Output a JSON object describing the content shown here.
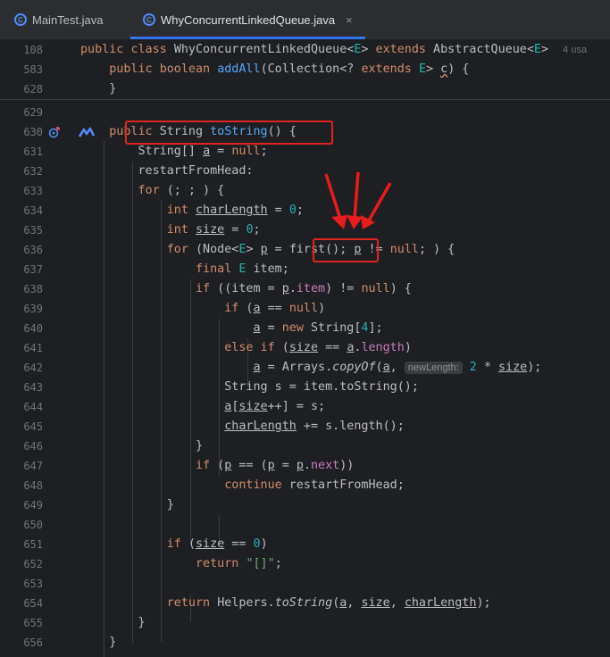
{
  "tabs": [
    {
      "label": "MainTest.java",
      "active": false
    },
    {
      "label": "WhyConcurrentLinkedQueue.java",
      "active": true
    }
  ],
  "tab_close": "×",
  "sticky": [
    {
      "num": "108",
      "tokens": [
        {
          "t": "public ",
          "c": "kw"
        },
        {
          "t": "class ",
          "c": "kw"
        },
        {
          "t": "WhyConcurrentLinkedQueue<",
          "c": ""
        },
        {
          "t": "E",
          "c": "tp"
        },
        {
          "t": "> ",
          "c": ""
        },
        {
          "t": "extends ",
          "c": "kw"
        },
        {
          "t": "AbstractQueue<",
          "c": ""
        },
        {
          "t": "E",
          "c": "tp"
        },
        {
          "t": ">  ",
          "c": ""
        },
        {
          "t": "4 usa",
          "c": "muted"
        }
      ]
    },
    {
      "num": "583",
      "tokens": [
        {
          "t": "    public ",
          "c": "kw"
        },
        {
          "t": "boolean ",
          "c": "kw"
        },
        {
          "t": "addAll",
          "c": "fn"
        },
        {
          "t": "(Collection<? ",
          "c": ""
        },
        {
          "t": "extends ",
          "c": "kw"
        },
        {
          "t": "E",
          "c": "tp"
        },
        {
          "t": "> ",
          "c": ""
        },
        {
          "t": "c",
          "c": "wavy"
        },
        {
          "t": ") {",
          "c": ""
        }
      ]
    },
    {
      "num": "628",
      "tokens": [
        {
          "t": "    }",
          "c": ""
        }
      ]
    }
  ],
  "lines": [
    {
      "num": "629",
      "tokens": []
    },
    {
      "num": "630",
      "tokens": [
        {
          "t": "    public ",
          "c": "kw"
        },
        {
          "t": "String ",
          "c": ""
        },
        {
          "t": "toString",
          "c": "fn"
        },
        {
          "t": "() {",
          "c": ""
        }
      ]
    },
    {
      "num": "631",
      "tokens": [
        {
          "t": "        String[] ",
          "c": ""
        },
        {
          "t": "a",
          "c": "ul"
        },
        {
          "t": " = ",
          "c": ""
        },
        {
          "t": "null",
          "c": "kw"
        },
        {
          "t": ";",
          "c": ""
        }
      ]
    },
    {
      "num": "632",
      "tokens": [
        {
          "t": "        restartFromHead:",
          "c": ""
        }
      ]
    },
    {
      "num": "633",
      "tokens": [
        {
          "t": "        ",
          "c": ""
        },
        {
          "t": "for",
          "c": "kw"
        },
        {
          "t": " (; ; ) {",
          "c": ""
        }
      ]
    },
    {
      "num": "634",
      "tokens": [
        {
          "t": "            ",
          "c": ""
        },
        {
          "t": "int ",
          "c": "kw"
        },
        {
          "t": "charLength",
          "c": "ul"
        },
        {
          "t": " = ",
          "c": ""
        },
        {
          "t": "0",
          "c": "num-lit"
        },
        {
          "t": ";",
          "c": ""
        }
      ]
    },
    {
      "num": "635",
      "tokens": [
        {
          "t": "            ",
          "c": ""
        },
        {
          "t": "int ",
          "c": "kw"
        },
        {
          "t": "size",
          "c": "ul"
        },
        {
          "t": " = ",
          "c": ""
        },
        {
          "t": "0",
          "c": "num-lit"
        },
        {
          "t": ";",
          "c": ""
        }
      ]
    },
    {
      "num": "636",
      "tokens": [
        {
          "t": "            ",
          "c": ""
        },
        {
          "t": "for",
          "c": "kw"
        },
        {
          "t": " (Node<",
          "c": ""
        },
        {
          "t": "E",
          "c": "tp"
        },
        {
          "t": "> ",
          "c": ""
        },
        {
          "t": "p",
          "c": "ul"
        },
        {
          "t": " = ",
          "c": ""
        },
        {
          "t": "first",
          "c": ""
        },
        {
          "t": "(); ",
          "c": ""
        },
        {
          "t": "p",
          "c": "ul"
        },
        {
          "t": " != ",
          "c": ""
        },
        {
          "t": "null",
          "c": "kw"
        },
        {
          "t": "; ) {",
          "c": ""
        }
      ]
    },
    {
      "num": "637",
      "tokens": [
        {
          "t": "                ",
          "c": ""
        },
        {
          "t": "final ",
          "c": "kw"
        },
        {
          "t": "E",
          "c": "tp"
        },
        {
          "t": " item;",
          "c": ""
        }
      ]
    },
    {
      "num": "638",
      "tokens": [
        {
          "t": "                ",
          "c": ""
        },
        {
          "t": "if",
          "c": "kw"
        },
        {
          "t": " ((item = ",
          "c": ""
        },
        {
          "t": "p",
          "c": "ul"
        },
        {
          "t": ".",
          "c": ""
        },
        {
          "t": "item",
          "c": "fld"
        },
        {
          "t": ") != ",
          "c": ""
        },
        {
          "t": "null",
          "c": "kw"
        },
        {
          "t": ") {",
          "c": ""
        }
      ]
    },
    {
      "num": "639",
      "tokens": [
        {
          "t": "                    ",
          "c": ""
        },
        {
          "t": "if",
          "c": "kw"
        },
        {
          "t": " (",
          "c": ""
        },
        {
          "t": "a",
          "c": "ul"
        },
        {
          "t": " == ",
          "c": ""
        },
        {
          "t": "null",
          "c": "kw"
        },
        {
          "t": ")",
          "c": ""
        }
      ]
    },
    {
      "num": "640",
      "tokens": [
        {
          "t": "                        ",
          "c": ""
        },
        {
          "t": "a",
          "c": "ul"
        },
        {
          "t": " = ",
          "c": ""
        },
        {
          "t": "new ",
          "c": "kw"
        },
        {
          "t": "String[",
          "c": ""
        },
        {
          "t": "4",
          "c": "num-lit"
        },
        {
          "t": "];",
          "c": ""
        }
      ]
    },
    {
      "num": "641",
      "tokens": [
        {
          "t": "                    ",
          "c": ""
        },
        {
          "t": "else if",
          "c": "kw"
        },
        {
          "t": " (",
          "c": ""
        },
        {
          "t": "size",
          "c": "ul"
        },
        {
          "t": " == ",
          "c": ""
        },
        {
          "t": "a",
          "c": "ul"
        },
        {
          "t": ".",
          "c": ""
        },
        {
          "t": "length",
          "c": "fld"
        },
        {
          "t": ")",
          "c": ""
        }
      ]
    },
    {
      "num": "642",
      "tokens": [
        {
          "t": "                        ",
          "c": ""
        },
        {
          "t": "a",
          "c": "ul"
        },
        {
          "t": " = Arrays.",
          "c": ""
        },
        {
          "t": "copyOf",
          "c": "it"
        },
        {
          "t": "(",
          "c": ""
        },
        {
          "t": "a",
          "c": "ul"
        },
        {
          "t": ", ",
          "c": ""
        },
        {
          "t": "newLength:",
          "c": "hint"
        },
        {
          "t": " ",
          "c": ""
        },
        {
          "t": "2",
          "c": "num-lit"
        },
        {
          "t": " * ",
          "c": ""
        },
        {
          "t": "size",
          "c": "ul"
        },
        {
          "t": ");",
          "c": ""
        }
      ]
    },
    {
      "num": "643",
      "tokens": [
        {
          "t": "                    String s = item.toString();",
          "c": ""
        }
      ]
    },
    {
      "num": "644",
      "tokens": [
        {
          "t": "                    ",
          "c": ""
        },
        {
          "t": "a",
          "c": "ul"
        },
        {
          "t": "[",
          "c": ""
        },
        {
          "t": "size",
          "c": "ul"
        },
        {
          "t": "++] = s;",
          "c": ""
        }
      ]
    },
    {
      "num": "645",
      "tokens": [
        {
          "t": "                    ",
          "c": ""
        },
        {
          "t": "charLength",
          "c": "ul"
        },
        {
          "t": " += s.length();",
          "c": ""
        }
      ]
    },
    {
      "num": "646",
      "tokens": [
        {
          "t": "                }",
          "c": ""
        }
      ]
    },
    {
      "num": "647",
      "tokens": [
        {
          "t": "                ",
          "c": ""
        },
        {
          "t": "if",
          "c": "kw"
        },
        {
          "t": " (",
          "c": ""
        },
        {
          "t": "p",
          "c": "ul"
        },
        {
          "t": " == (",
          "c": ""
        },
        {
          "t": "p",
          "c": "ul"
        },
        {
          "t": " = ",
          "c": ""
        },
        {
          "t": "p",
          "c": "ul"
        },
        {
          "t": ".",
          "c": ""
        },
        {
          "t": "next",
          "c": "fld"
        },
        {
          "t": "))",
          "c": ""
        }
      ]
    },
    {
      "num": "648",
      "tokens": [
        {
          "t": "                    ",
          "c": ""
        },
        {
          "t": "continue",
          "c": "kw"
        },
        {
          "t": " restartFromHead;",
          "c": ""
        }
      ]
    },
    {
      "num": "649",
      "tokens": [
        {
          "t": "            }",
          "c": ""
        }
      ]
    },
    {
      "num": "650",
      "tokens": []
    },
    {
      "num": "651",
      "tokens": [
        {
          "t": "            ",
          "c": ""
        },
        {
          "t": "if",
          "c": "kw"
        },
        {
          "t": " (",
          "c": ""
        },
        {
          "t": "size",
          "c": "ul"
        },
        {
          "t": " == ",
          "c": ""
        },
        {
          "t": "0",
          "c": "num-lit"
        },
        {
          "t": ")",
          "c": ""
        }
      ]
    },
    {
      "num": "652",
      "tokens": [
        {
          "t": "                ",
          "c": ""
        },
        {
          "t": "return ",
          "c": "kw"
        },
        {
          "t": "\"[]\"",
          "c": "str"
        },
        {
          "t": ";",
          "c": ""
        }
      ]
    },
    {
      "num": "653",
      "tokens": []
    },
    {
      "num": "654",
      "tokens": [
        {
          "t": "            ",
          "c": ""
        },
        {
          "t": "return ",
          "c": "kw"
        },
        {
          "t": "Helpers.",
          "c": ""
        },
        {
          "t": "toString",
          "c": "it"
        },
        {
          "t": "(",
          "c": ""
        },
        {
          "t": "a",
          "c": "ul"
        },
        {
          "t": ", ",
          "c": ""
        },
        {
          "t": "size",
          "c": "ul"
        },
        {
          "t": ", ",
          "c": ""
        },
        {
          "t": "charLength",
          "c": "ul"
        },
        {
          "t": ");",
          "c": ""
        }
      ]
    },
    {
      "num": "655",
      "tokens": [
        {
          "t": "        }",
          "c": ""
        }
      ]
    },
    {
      "num": "656",
      "tokens": [
        {
          "t": "    }",
          "c": ""
        }
      ]
    }
  ],
  "gutter_icons": [
    "override-icon",
    "implementation-icon"
  ]
}
